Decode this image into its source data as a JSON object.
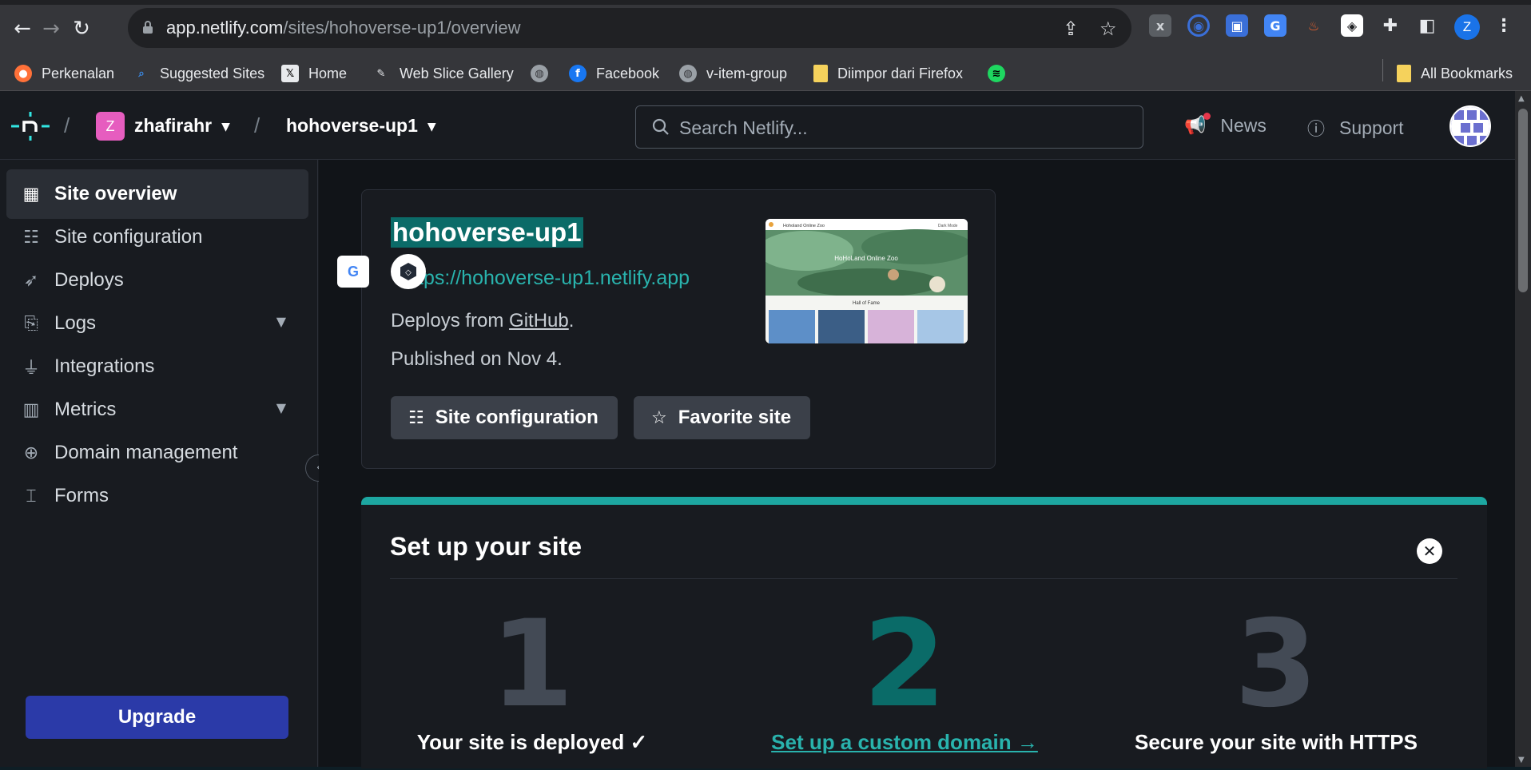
{
  "browser": {
    "url_host": "app.netlify.com",
    "url_path": "/sites/hohoverse-up1/overview",
    "profile_initial": "Z",
    "bookmarks": [
      {
        "label": "Perkenalan",
        "icon": "firefox-icon"
      },
      {
        "label": "Suggested Sites",
        "icon": "search-icon"
      },
      {
        "label": "Home",
        "icon": "x-logo-icon"
      },
      {
        "label": "Web Slice Gallery",
        "icon": "web-slice-icon"
      },
      {
        "label": "",
        "icon": "globe-icon"
      },
      {
        "label": "Facebook",
        "icon": "facebook-icon"
      },
      {
        "label": "v-item-group",
        "icon": "globe-icon"
      },
      {
        "label": "Diimpor dari Firefox",
        "icon": "folder-icon"
      },
      {
        "label": "",
        "icon": "spotify-icon"
      }
    ],
    "all_bookmarks": "All Bookmarks"
  },
  "topbar": {
    "team_initial": "Z",
    "team_name": "zhafirahr",
    "site_name": "hohoverse-up1",
    "search_placeholder": "Search Netlify...",
    "news": "News",
    "support": "Support"
  },
  "sidebar": {
    "items": [
      {
        "label": "Site overview",
        "active": true
      },
      {
        "label": "Site configuration"
      },
      {
        "label": "Deploys"
      },
      {
        "label": "Logs",
        "expandable": true
      },
      {
        "label": "Integrations"
      },
      {
        "label": "Metrics",
        "expandable": true
      },
      {
        "label": "Domain management"
      },
      {
        "label": "Forms"
      }
    ],
    "upgrade": "Upgrade"
  },
  "site_card": {
    "name": "hohoverse-up1",
    "url": "https://hohoverse-up1.netlify.app",
    "url_visible": "tps://hohoverse-up1.netlify.app",
    "deploys_prefix": "Deploys from ",
    "deploys_source": "GitHub",
    "deploys_suffix": ".",
    "published": "Published on Nov 4.",
    "thumbnail": {
      "header": "Hoholand Online Zoo",
      "hero_title": "HoHoLand Online Zoo",
      "section": "Hall of Fame",
      "corner": "Dark Mode"
    },
    "btn_config": "Site configuration",
    "btn_favorite": "Favorite site"
  },
  "setup": {
    "title": "Set up your site",
    "steps": [
      {
        "number": "1",
        "label": "Your site is deployed ✓",
        "color": "#434a55"
      },
      {
        "number": "2",
        "label": "Set up a custom domain →",
        "color": "#0a6b68"
      },
      {
        "number": "3",
        "label": "Secure your site with HTTPS",
        "color": "#434a55"
      }
    ]
  },
  "colors": {
    "accent": "#1da7a1",
    "upgrade": "#2b3aa8",
    "team_badge": "#e65dbf"
  }
}
